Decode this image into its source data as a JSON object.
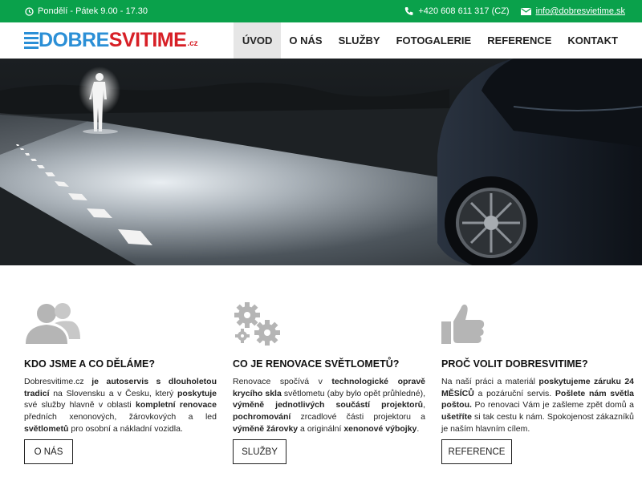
{
  "topbar": {
    "hours": "Pondělí - Pátek 9.00 - 17.30",
    "phone": "+420 608 611 317 (CZ)",
    "email": "info@dobresvietime.sk"
  },
  "logo": {
    "part1": "DOBRE",
    "part2": "SVITIME",
    "tld": ".cz"
  },
  "nav": [
    "ÚVOD",
    "O NÁS",
    "SLUŽBY",
    "FOTOGALERIE",
    "REFERENCE",
    "KONTAKT"
  ],
  "nav_active": "ÚVOD",
  "features": [
    {
      "icon": "users-icon",
      "title": "KDO JSME A CO DĚLÁME?",
      "text": [
        [
          "Dobresvitime.cz ",
          false
        ],
        [
          "je autoservis s dlouholetou tradicí",
          true
        ],
        [
          " na Slovensku a v Česku, který ",
          false
        ],
        [
          "poskytuje",
          true
        ],
        [
          " své služby hlavně v oblasti ",
          false
        ],
        [
          "kompletní renovace",
          true
        ],
        [
          " předních xenonových, žárovkových a led ",
          false
        ],
        [
          "světlometů",
          true
        ],
        [
          " pro osobní a nákladní vozidla.",
          false
        ]
      ],
      "button": "O NÁS"
    },
    {
      "icon": "gears-icon",
      "title": "CO JE RENOVACE SVĚTLOMETŮ?",
      "text": [
        [
          "Renovace spočívá v ",
          false
        ],
        [
          "technologické opravě krycího skla",
          true
        ],
        [
          " světlometu (aby bylo opět průhledné), ",
          false
        ],
        [
          "výměně jednotlivých součástí projektorů",
          true
        ],
        [
          ", ",
          false
        ],
        [
          "pochromování",
          true
        ],
        [
          " zrcadlové části projektoru a ",
          false
        ],
        [
          "výměně žárovky",
          true
        ],
        [
          " a originální ",
          false
        ],
        [
          "xenonové výbojky",
          true
        ],
        [
          ".",
          false
        ]
      ],
      "button": "SLUŽBY"
    },
    {
      "icon": "thumbs-up-icon",
      "title": "PROČ VOLIT DOBRESVITIME?",
      "text": [
        [
          "Na naší práci a materiál ",
          false
        ],
        [
          "poskytujeme záruku 24 MĚSÍCŮ",
          true
        ],
        [
          " a pozáruční servis. ",
          false
        ],
        [
          "Pošlete nám světla poštou.",
          true
        ],
        [
          " Po renovaci Vám je zašleme zpět domů a ",
          false
        ],
        [
          "ušetříte",
          true
        ],
        [
          " si tak cestu k nám. Spokojenost zákazníků je naším hlavním cílem.",
          false
        ]
      ],
      "button": "REFERENCE"
    }
  ],
  "colors": {
    "topbar": "#0aa14b",
    "logo_blue": "#2b8fd6",
    "logo_red": "#d71f26",
    "icon_gray": "#b5b5b5"
  }
}
